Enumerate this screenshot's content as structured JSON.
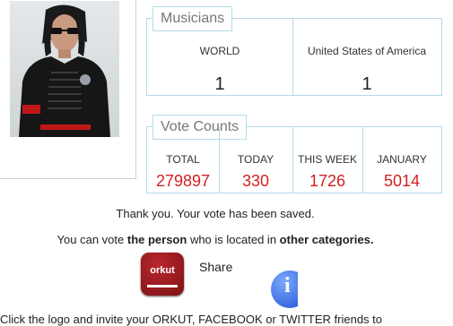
{
  "musicians": {
    "legend": "Musicians",
    "columns": [
      {
        "label": "WORLD",
        "value": "1"
      },
      {
        "label": "United States of America",
        "value": "1"
      }
    ]
  },
  "votes": {
    "legend": "Vote Counts",
    "columns": [
      {
        "label": "TOTAL",
        "value": "279897"
      },
      {
        "label": "TODAY",
        "value": "330"
      },
      {
        "label": "THIS WEEK",
        "value": "1726"
      },
      {
        "label": "JANUARY",
        "value": "5014"
      }
    ]
  },
  "messages": {
    "saved": "Thank you. Your vote has been saved.",
    "vote_prefix": "You can vote ",
    "vote_person": "the person",
    "vote_middle": " who is located in ",
    "vote_categories": "other categories.",
    "invite": "Click the logo and invite your ORKUT, FACEBOOK or TWITTER friends to"
  },
  "share": {
    "orkut_text": "orkut",
    "label": "Share",
    "info_glyph": "i"
  },
  "colors": {
    "border": "#b4dbe9",
    "vote_value": "#d42020",
    "orkut": "#9b1b20",
    "info": "#2a5be0"
  },
  "icons": [
    "orkut-logo-icon",
    "info-icon"
  ]
}
